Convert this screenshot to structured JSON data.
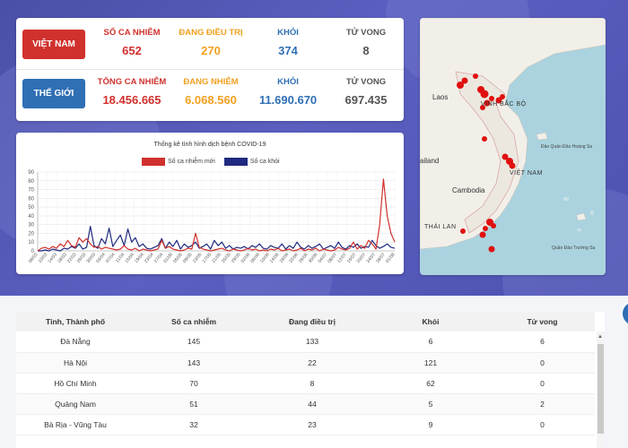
{
  "vietnam": {
    "region": "VIỆT NAM",
    "stats": [
      {
        "label": "SỐ CA NHIỄM",
        "value": "652",
        "color": "#d0312d"
      },
      {
        "label": "ĐANG ĐIỀU TRỊ",
        "value": "270",
        "color": "#f0a020"
      },
      {
        "label": "KHỎI",
        "value": "374",
        "color": "#2f6fb5"
      },
      {
        "label": "TỬ VONG",
        "value": "8",
        "color": "#555555"
      }
    ]
  },
  "world": {
    "region": "THẾ GIỚI",
    "stats": [
      {
        "label": "TỔNG CA NHIỄM",
        "value": "18.456.665",
        "color": "#d0312d"
      },
      {
        "label": "ĐANG NHIỄM",
        "value": "6.068.560",
        "color": "#f0a020"
      },
      {
        "label": "KHỎI",
        "value": "11.690.670",
        "color": "#2f6fb5"
      },
      {
        "label": "TỬ VONG",
        "value": "697.435",
        "color": "#555555"
      }
    ]
  },
  "chart_data": {
    "type": "line",
    "title": "Thống kê tình hình dịch bệnh COVID-19",
    "xlabel": "",
    "ylabel": "",
    "ylim": [
      0,
      90
    ],
    "yticks": [
      0,
      10,
      20,
      30,
      40,
      50,
      60,
      70,
      80,
      90
    ],
    "grid": true,
    "legend": "top",
    "x_tick_labels": [
      "06/03",
      "10/03",
      "14/03",
      "18/03",
      "22/03",
      "26/03",
      "30/03",
      "03/04",
      "07/04",
      "11/04",
      "15/04",
      "19/04",
      "23/04",
      "27/04",
      "01/05",
      "05/05",
      "09/05",
      "13/05",
      "17/05",
      "21/05",
      "25/05",
      "29/05",
      "02/06",
      "06/06",
      "10/06",
      "14/06",
      "18/06",
      "22/06",
      "26/06",
      "30/06",
      "04/07",
      "08/07",
      "12/07",
      "16/07",
      "20/07",
      "24/07",
      "28/07",
      "01/08"
    ],
    "series": [
      {
        "name": "Số ca nhiễm mới",
        "color": "#d0312d",
        "values": [
          0,
          3,
          4,
          2,
          5,
          3,
          8,
          5,
          12,
          6,
          4,
          15,
          10,
          14,
          8,
          4,
          5,
          2,
          4,
          3,
          2,
          1,
          2,
          6,
          2,
          1,
          3,
          0,
          2,
          1,
          0,
          1,
          2,
          12,
          3,
          5,
          2,
          1,
          0,
          1,
          3,
          2,
          20,
          4,
          2,
          1,
          0,
          1,
          2,
          3,
          1,
          0,
          2,
          1,
          0,
          1,
          3,
          1,
          2,
          0,
          1,
          0,
          2,
          1,
          3,
          0,
          1,
          2,
          0,
          1,
          3,
          0,
          2,
          1,
          3,
          0,
          2,
          1,
          0,
          1,
          4,
          2,
          1,
          3,
          10,
          2,
          6,
          3,
          12,
          8,
          2,
          30,
          82,
          40,
          20,
          10
        ]
      },
      {
        "name": "Số ca khỏi",
        "color": "#1f2a80",
        "values": [
          0,
          0,
          1,
          0,
          2,
          1,
          0,
          3,
          2,
          5,
          3,
          8,
          2,
          4,
          28,
          6,
          3,
          14,
          8,
          26,
          5,
          12,
          18,
          6,
          25,
          10,
          15,
          5,
          8,
          3,
          2,
          4,
          6,
          14,
          3,
          10,
          5,
          12,
          2,
          8,
          4,
          6,
          10,
          3,
          5,
          8,
          2,
          12,
          6,
          10,
          3,
          6,
          2,
          4,
          3,
          5,
          2,
          6,
          4,
          8,
          3,
          2,
          6,
          4,
          3,
          8,
          2,
          6,
          3,
          10,
          4,
          2,
          6,
          3,
          5,
          8,
          2,
          4,
          6,
          3,
          10,
          4,
          2,
          6,
          4,
          8,
          3,
          5,
          4,
          12,
          6,
          3,
          5,
          8,
          4,
          3
        ]
      }
    ]
  },
  "map": {
    "labels": [
      {
        "text": "Laos",
        "key": "laos"
      },
      {
        "text": "Vịnh Bắc Bộ",
        "key": "gulf"
      },
      {
        "text": "Đảo Quần Đảo Hoàng Sa",
        "key": "hoangsa"
      },
      {
        "text": "VIỆT NAM",
        "key": "vn"
      },
      {
        "text": "ailand",
        "key": "thai"
      },
      {
        "text": "Cambodia",
        "key": "cambodia"
      },
      {
        "text": "THÁI LAN",
        "key": "thailan"
      },
      {
        "text": "Quần Đảo Trường Sa",
        "key": "truongsa"
      }
    ]
  },
  "table": {
    "headers": [
      "Tỉnh, Thành phố",
      "Số ca nhiễm",
      "Đang điều trị",
      "Khỏi",
      "Tử vong"
    ],
    "rows": [
      [
        "Đà Nẵng",
        "145",
        "133",
        "6",
        "6"
      ],
      [
        "Hà Nội",
        "143",
        "22",
        "121",
        "0"
      ],
      [
        "Hồ Chí Minh",
        "70",
        "8",
        "62",
        "0"
      ],
      [
        "Quảng Nam",
        "51",
        "44",
        "5",
        "2"
      ],
      [
        "Bà Rịa - Vũng Tàu",
        "32",
        "23",
        "9",
        "0"
      ]
    ]
  }
}
